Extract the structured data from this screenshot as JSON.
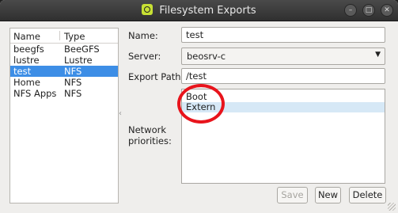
{
  "window": {
    "title": "Filesystem Exports",
    "controls": {
      "minimize": "–",
      "maximize": "□",
      "close": "✕"
    }
  },
  "filesystems": {
    "headers": [
      "Name",
      "Type"
    ],
    "rows": [
      {
        "name": "beegfs",
        "type": "BeeGFS",
        "selected": false
      },
      {
        "name": "lustre",
        "type": "Lustre",
        "selected": false
      },
      {
        "name": "test",
        "type": "NFS",
        "selected": true
      },
      {
        "name": "Home",
        "type": "NFS",
        "selected": false
      },
      {
        "name": "NFS Apps",
        "type": "NFS",
        "selected": false
      }
    ]
  },
  "form": {
    "name_label": "Name:",
    "name_value": "test",
    "server_label": "Server:",
    "server_value": "beosrv-c",
    "export_label": "Export Path:",
    "export_value": "/test",
    "priorities_label": "Network priorities:",
    "priorities": [
      "Boot",
      "Extern"
    ],
    "highlighted_priority": "Extern"
  },
  "buttons": {
    "save": "Save",
    "new": "New",
    "delete": "Delete"
  },
  "colors": {
    "selection": "#3d8ee6",
    "annotation_circle": "#e8141c",
    "app_icon": "#c7e034"
  }
}
